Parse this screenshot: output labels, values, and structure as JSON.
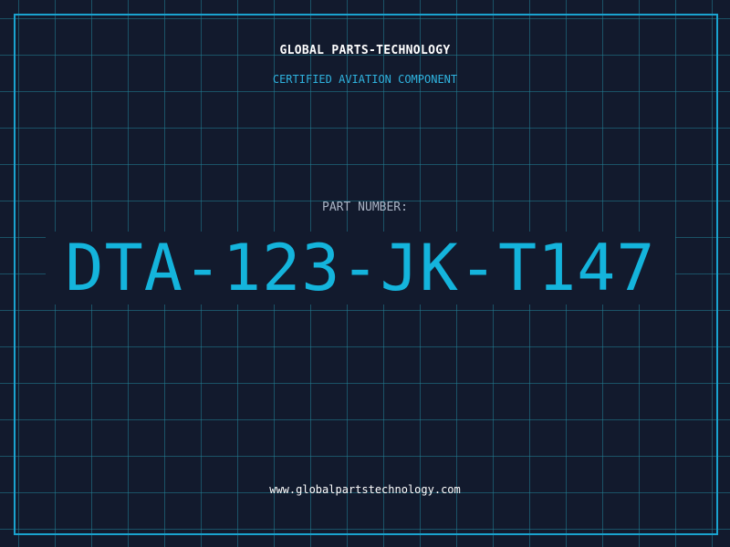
{
  "header": {
    "company": "GLOBAL PARTS-TECHNOLOGY",
    "subtitle": "CERTIFIED AVIATION COMPONENT"
  },
  "part": {
    "label": "PART NUMBER:",
    "number": "DTA-123-JK-T147"
  },
  "footer": {
    "url": "www.globalpartstechnology.com"
  },
  "colors": {
    "background": "#121a2d",
    "grid": "#228096",
    "accent": "#14b4dc",
    "frame": "#1aa3cf",
    "text": "#ffffff",
    "label": "#a9b3c4"
  }
}
